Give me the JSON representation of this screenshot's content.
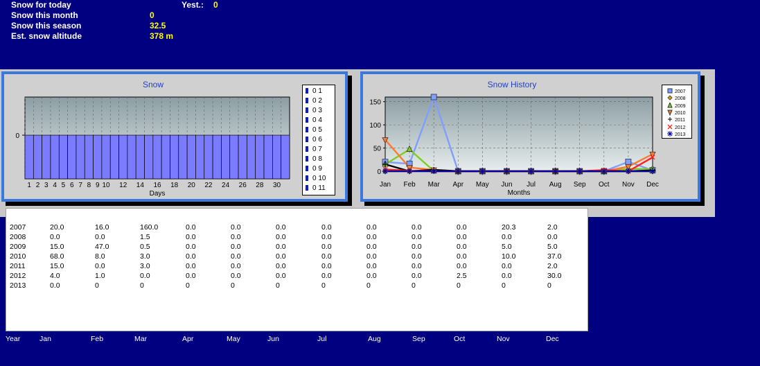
{
  "info": [
    {
      "label": "Snow for today",
      "value": ""
    },
    {
      "label": "Snow this month",
      "value": "0"
    },
    {
      "label": "Snow this season",
      "value": "32.5"
    },
    {
      "label": "Est. snow altitude",
      "value": "378 m"
    }
  ],
  "yesterday": {
    "label": "Yest.:",
    "value": "0"
  },
  "snow_chart": {
    "title": "Snow",
    "xlabel": "Days",
    "ytick": "0",
    "legend": [
      "0 1",
      "0 2",
      "0 3",
      "0 4",
      "0 5",
      "0 6",
      "0 7",
      "0 8",
      "0 9",
      "0 10",
      "0 11"
    ],
    "colors": {
      "bar": "#7b7bff",
      "legend": "#0a1ccf"
    }
  },
  "chart_data": [
    {
      "type": "bar",
      "title": "Snow",
      "xlabel": "Days",
      "ylabel": "",
      "x": [
        1,
        2,
        3,
        4,
        5,
        6,
        7,
        8,
        9,
        10,
        11,
        12,
        13,
        14,
        15,
        16,
        17,
        18,
        19,
        20,
        21,
        22,
        23,
        24,
        25,
        26,
        27,
        28,
        29,
        30,
        31
      ],
      "values": [
        0,
        0,
        0,
        0,
        0,
        0,
        0,
        0,
        0,
        0,
        0,
        0,
        0,
        0,
        0,
        0,
        0,
        0,
        0,
        0,
        0,
        0,
        0,
        0,
        0,
        0,
        0,
        0,
        0,
        0,
        0
      ],
      "xticks": [
        "1",
        "2",
        "3",
        "4",
        "5",
        "6",
        "7",
        "8",
        "9",
        "10",
        "12",
        "14",
        "16",
        "18",
        "20",
        "22",
        "24",
        "26",
        "28",
        "30"
      ],
      "yticks": [
        "0"
      ],
      "grid": true,
      "legend_position": "right"
    },
    {
      "type": "line",
      "title": "Snow History",
      "xlabel": "Months",
      "ylabel": "",
      "categories": [
        "Jan",
        "Feb",
        "Mar",
        "Apr",
        "May",
        "Jun",
        "Jul",
        "Aug",
        "Sep",
        "Oct",
        "Nov",
        "Dec"
      ],
      "ylim": [
        0,
        160
      ],
      "yticks": [
        "0",
        "50",
        "100",
        "150"
      ],
      "grid": true,
      "legend_position": "right",
      "series": [
        {
          "name": "2007",
          "color": "#7f9fff",
          "values": [
            20.0,
            16.0,
            160.0,
            0,
            0,
            0,
            0,
            0,
            0,
            0,
            20.3,
            2.0
          ]
        },
        {
          "name": "2008",
          "color": "#d4a000",
          "values": [
            0,
            0,
            1.5,
            0,
            0,
            0,
            0,
            0,
            0,
            0,
            0,
            0
          ]
        },
        {
          "name": "2009",
          "color": "#7ccf20",
          "values": [
            15.0,
            47.0,
            0.5,
            0,
            0,
            0,
            0,
            0,
            0,
            0,
            5.0,
            5.0
          ]
        },
        {
          "name": "2010",
          "color": "#ff7a30",
          "values": [
            68.0,
            8.0,
            3.0,
            0,
            0,
            0,
            0,
            0,
            0,
            0,
            10.0,
            37.0
          ]
        },
        {
          "name": "2011",
          "color": "#000000",
          "values": [
            15.0,
            0,
            3.0,
            0,
            0,
            0,
            0,
            0,
            0,
            0,
            0,
            2.0
          ]
        },
        {
          "name": "2012",
          "color": "#ff2020",
          "values": [
            4.0,
            1.0,
            0,
            0,
            0,
            0,
            0,
            0,
            0,
            2.5,
            0,
            30.0
          ]
        },
        {
          "name": "2013",
          "color": "#0000a0",
          "values": [
            0,
            0,
            0,
            0,
            0,
            0,
            0,
            0,
            0,
            0,
            0,
            0
          ]
        }
      ]
    }
  ],
  "table": {
    "headers": [
      "Year",
      "Jan",
      "Feb",
      "Mar",
      "Apr",
      "May",
      "Jun",
      "Jul",
      "Aug",
      "Sep",
      "Oct",
      "Nov",
      "Dec"
    ],
    "rows": [
      [
        "2007",
        "20.0",
        "16.0",
        "160.0",
        "0.0",
        "0.0",
        "0.0",
        "0.0",
        "0.0",
        "0.0",
        "0.0",
        "20.3",
        "2.0"
      ],
      [
        "2008",
        "0.0",
        "0.0",
        "1.5",
        "0.0",
        "0.0",
        "0.0",
        "0.0",
        "0.0",
        "0.0",
        "0.0",
        "0.0",
        "0.0"
      ],
      [
        "2009",
        "15.0",
        "47.0",
        "0.5",
        "0.0",
        "0.0",
        "0.0",
        "0.0",
        "0.0",
        "0.0",
        "0.0",
        "5.0",
        "5.0"
      ],
      [
        "2010",
        "68.0",
        "8.0",
        "3.0",
        "0.0",
        "0.0",
        "0.0",
        "0.0",
        "0.0",
        "0.0",
        "0.0",
        "10.0",
        "37.0"
      ],
      [
        "2011",
        "15.0",
        "0.0",
        "3.0",
        "0.0",
        "0.0",
        "0.0",
        "0.0",
        "0.0",
        "0.0",
        "0.0",
        "0.0",
        "2.0"
      ],
      [
        "2012",
        "4.0",
        "1.0",
        "0.0",
        "0.0",
        "0.0",
        "0.0",
        "0.0",
        "0.0",
        "0.0",
        "2.5",
        "0.0",
        "30.0"
      ],
      [
        "2013",
        "0.0",
        "0",
        "0",
        "0",
        "0",
        "0",
        "0",
        "0",
        "0",
        "0",
        "0",
        "0"
      ]
    ]
  }
}
